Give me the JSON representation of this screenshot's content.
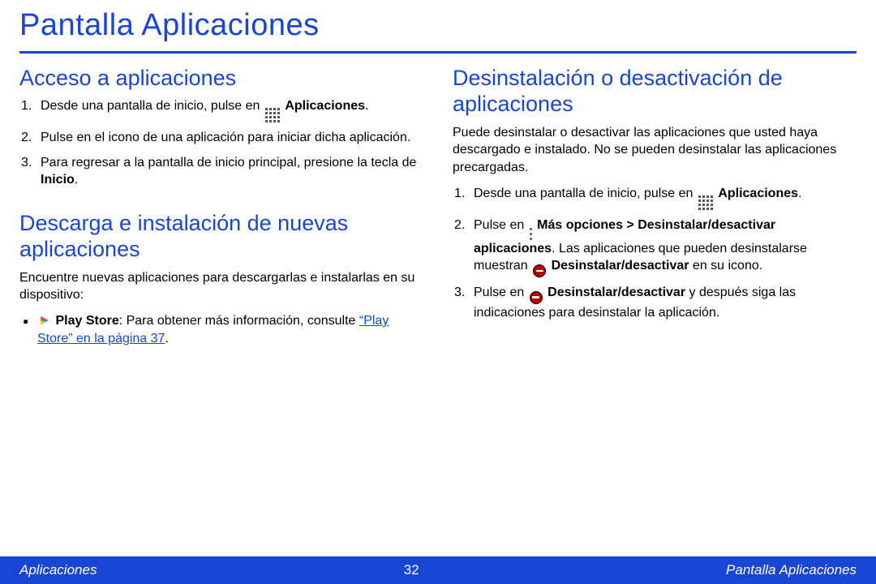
{
  "page_title": "Pantalla Aplicaciones",
  "left": {
    "h_access": "Acceso a aplicaciones",
    "access_items": {
      "n1": "1.",
      "i1a": "Desde una pantalla de inicio, pulse en ",
      "i1b": "Aplicaciones",
      "i1c": ".",
      "n2": "2.",
      "i2": "Pulse en el icono de una aplicación para iniciar dicha aplicación.",
      "n3": "3.",
      "i3a": "Para regresar a la pantalla de inicio principal, presione la tecla de ",
      "i3b": "Inicio",
      "i3c": "."
    },
    "h_download": "Descarga e instalación de nuevas aplicaciones",
    "download_intro": "Encuentre nuevas aplicaciones para descargarlas e instalarlas en su dispositivo:",
    "play": {
      "label": "Play Store",
      "after": ": Para obtener más información, consulte ",
      "link": "“Play Store” en la página 37",
      "period": "."
    }
  },
  "right": {
    "h_uninstall": "Desinstalación o desactivación de aplicaciones",
    "intro": "Puede desinstalar o desactivar las aplicaciones que usted haya descargado e instalado. No se pueden desinstalar las aplicaciones precargadas.",
    "items": {
      "n1": "1.",
      "i1a": "Desde una pantalla de inicio, pulse en ",
      "i1b": "Aplicaciones",
      "i1c": ".",
      "n2": "2.",
      "i2a": "Pulse en ",
      "i2b": "Más opciones > Desinstalar/desactivar aplicaciones",
      "i2c": ". Las aplicaciones que pueden desinstalarse muestran ",
      "i2d": "Desinstalar/desactivar",
      "i2e": " en su icono.",
      "n3": "3.",
      "i3a": "Pulse en ",
      "i3b": "Desinstalar/desactivar",
      "i3c": " y después siga las indicaciones para desinstalar la aplicación."
    }
  },
  "footer": {
    "left": "Aplicaciones",
    "center": "32",
    "right": "Pantalla Aplicaciones"
  }
}
